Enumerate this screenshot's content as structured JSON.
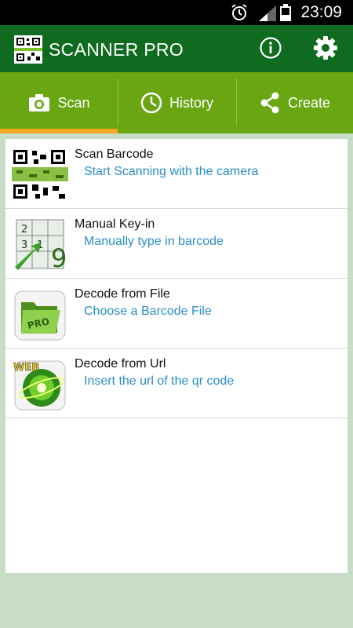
{
  "status_bar": {
    "time": "23:09"
  },
  "app_bar": {
    "title": "SCANNER PRO"
  },
  "tabs": [
    {
      "label": "Scan",
      "icon": "camera-icon",
      "selected": true
    },
    {
      "label": "History",
      "icon": "clock-icon",
      "selected": false
    },
    {
      "label": "Create",
      "icon": "share-icon",
      "selected": false
    }
  ],
  "items": [
    {
      "title": "Scan Barcode",
      "subtitle": "Start Scanning with the camera",
      "icon": "qr-code-icon"
    },
    {
      "title": "Manual Key-in",
      "subtitle": "Manually type in barcode",
      "icon": "keypad-icon"
    },
    {
      "title": "Decode from File",
      "subtitle": "Choose a Barcode File",
      "icon": "folder-icon"
    },
    {
      "title": "Decode from Url",
      "subtitle": "Insert the url of the qr code",
      "icon": "web-globe-icon"
    }
  ],
  "colors": {
    "app_bar": "#0f6b1f",
    "tab_bar": "#69a612",
    "tab_indicator": "#f5a623",
    "subtitle": "#2a8fc6",
    "background": "#c8dcc8"
  }
}
